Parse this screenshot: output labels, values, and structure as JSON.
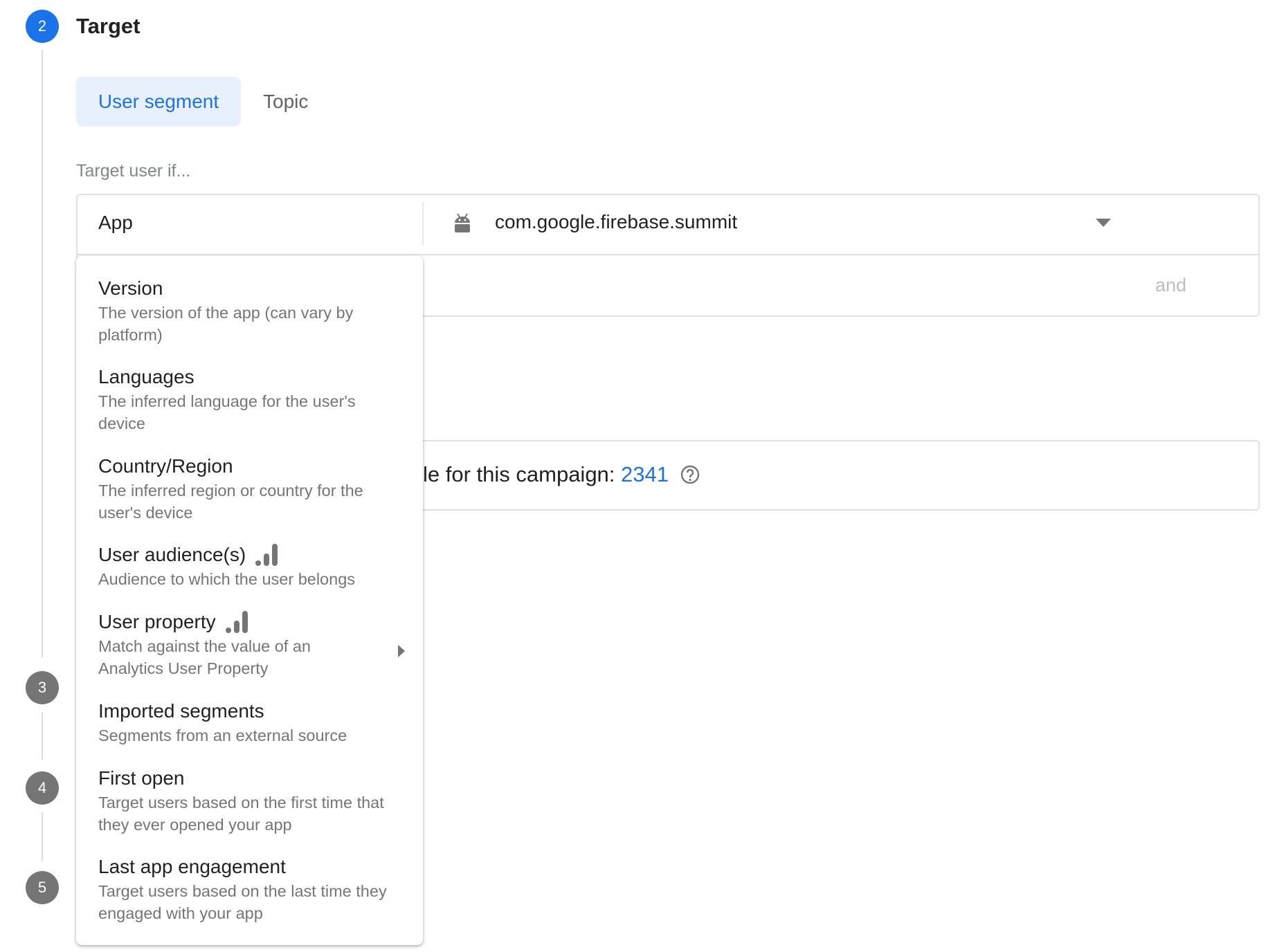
{
  "steps": [
    {
      "number": "2",
      "active": true
    },
    {
      "number": "3"
    },
    {
      "number": "4"
    },
    {
      "number": "5"
    }
  ],
  "section_title": "Target",
  "tabs": [
    {
      "label": "User segment",
      "selected": true
    },
    {
      "label": "Topic",
      "selected": false
    }
  ],
  "target_hint": "Target user if...",
  "condition": {
    "field": "App",
    "platform_icon": "android-icon",
    "value": "com.google.firebase.summit",
    "connector": "and"
  },
  "reach": {
    "text": "le for this campaign: ",
    "count": "2341",
    "icon": "help-circle-icon"
  },
  "menu": {
    "items": [
      {
        "title": "Version",
        "description": "The version of the app (can vary by platform)"
      },
      {
        "title": "Languages",
        "description": "The inferred language for the user's device"
      },
      {
        "title": "Country/Region",
        "description": "The inferred region or country for the user's device"
      },
      {
        "title": "User audience(s)",
        "description": "Audience to which the user belongs",
        "icon": "analytics-icon"
      },
      {
        "title": "User property",
        "description": "Match against the value of an Analytics User Property",
        "icon": "analytics-icon",
        "submenu": true
      },
      {
        "title": "Imported segments",
        "description": "Segments from an external source"
      },
      {
        "title": "First open",
        "description": "Target users based on the first time that they ever opened your app"
      },
      {
        "title": "Last app engagement",
        "description": "Target users based on the last time they engaged with your app"
      }
    ]
  },
  "colors": {
    "accent": "#1a73e8",
    "tab_selected_bg": "#e8f0fe",
    "step_idle": "#757575"
  }
}
